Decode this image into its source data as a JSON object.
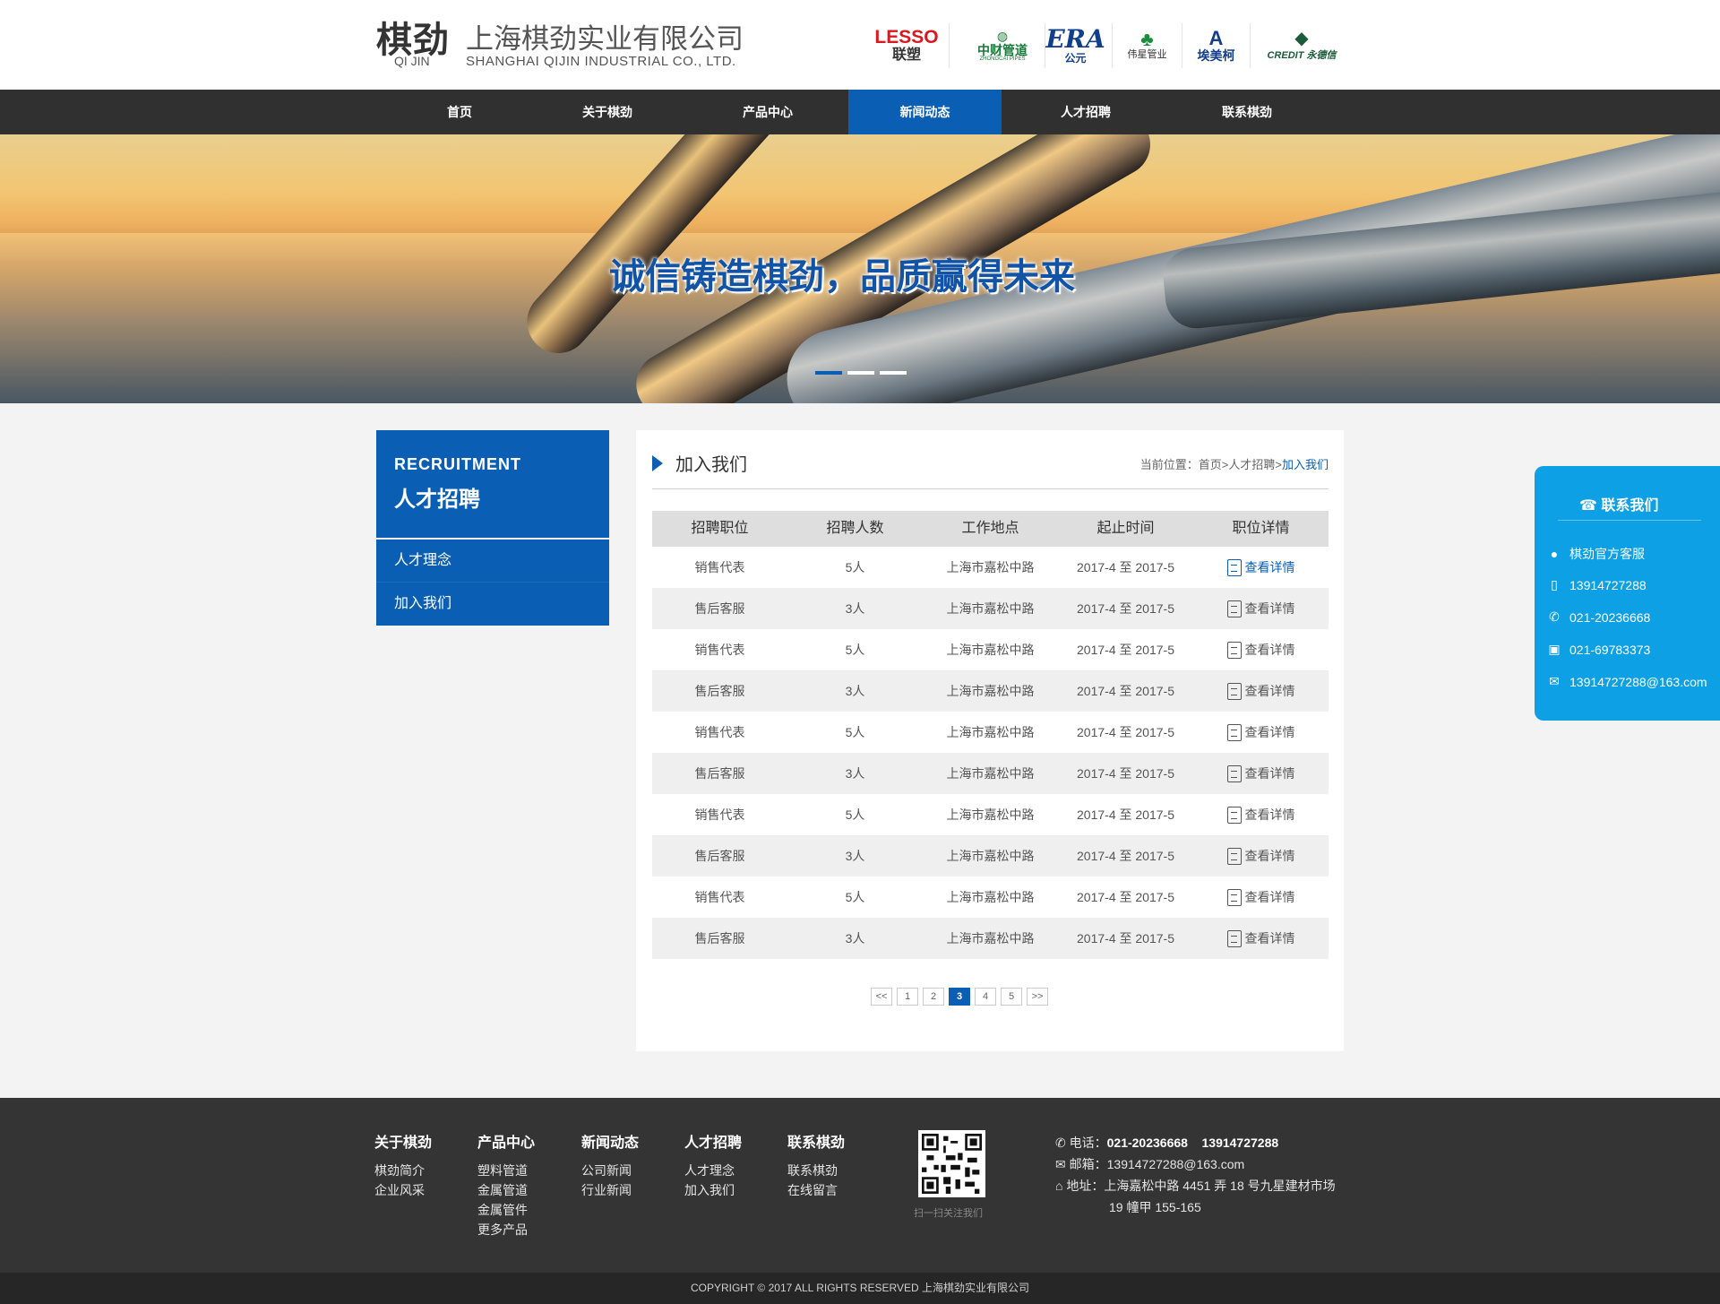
{
  "header": {
    "logo_cn": "棋劲",
    "logo_en": "QI JIN",
    "company_cn": "上海棋劲实业有限公司",
    "company_en": "SHANGHAI QIJIN INDUSTRIAL CO., LTD.",
    "brands": [
      {
        "name": "LESSO",
        "sub": "联塑"
      },
      {
        "name": "中财管道",
        "sub": "ZHONGCAI PIPES"
      },
      {
        "name": "ERA",
        "sub": "公元"
      },
      {
        "name": "伟星管业",
        "sub": ""
      },
      {
        "name": "埃美柯",
        "sub": ""
      },
      {
        "name": "CREDIT",
        "sub": "永德信"
      }
    ]
  },
  "nav": [
    "首页",
    "关于棋劲",
    "产品中心",
    "新闻动态",
    "人才招聘",
    "联系棋劲"
  ],
  "nav_active": "新闻动态",
  "banner": {
    "slogan": "诚信铸造棋劲，品质赢得未来",
    "slides": 3,
    "active_slide": 1
  },
  "sidebar": {
    "title_en": "RECRUITMENT",
    "title_cn": "人才招聘",
    "items": [
      "人才理念",
      "加入我们"
    ]
  },
  "main": {
    "title": "加入我们",
    "breadcrumb_prefix": "当前位置：",
    "breadcrumb": [
      "首页",
      "人才招聘",
      "加入我们"
    ],
    "headers": [
      "招聘职位",
      "招聘人数",
      "工作地点",
      "起止时间",
      "职位详情"
    ],
    "rows": [
      {
        "position": "销售代表",
        "count": "5人",
        "location": "上海市嘉松中路",
        "period": "2017-4 至 2017-5",
        "detail": "查看详情"
      },
      {
        "position": "售后客服",
        "count": "3人",
        "location": "上海市嘉松中路",
        "period": "2017-4 至 2017-5",
        "detail": "查看详情"
      },
      {
        "position": "销售代表",
        "count": "5人",
        "location": "上海市嘉松中路",
        "period": "2017-4 至 2017-5",
        "detail": "查看详情"
      },
      {
        "position": "售后客服",
        "count": "3人",
        "location": "上海市嘉松中路",
        "period": "2017-4 至 2017-5",
        "detail": "查看详情"
      },
      {
        "position": "销售代表",
        "count": "5人",
        "location": "上海市嘉松中路",
        "period": "2017-4 至 2017-5",
        "detail": "查看详情"
      },
      {
        "position": "售后客服",
        "count": "3人",
        "location": "上海市嘉松中路",
        "period": "2017-4 至 2017-5",
        "detail": "查看详情"
      },
      {
        "position": "销售代表",
        "count": "5人",
        "location": "上海市嘉松中路",
        "period": "2017-4 至 2017-5",
        "detail": "查看详情"
      },
      {
        "position": "售后客服",
        "count": "3人",
        "location": "上海市嘉松中路",
        "period": "2017-4 至 2017-5",
        "detail": "查看详情"
      },
      {
        "position": "销售代表",
        "count": "5人",
        "location": "上海市嘉松中路",
        "period": "2017-4 至 2017-5",
        "detail": "查看详情"
      },
      {
        "position": "售后客服",
        "count": "3人",
        "location": "上海市嘉松中路",
        "period": "2017-4 至 2017-5",
        "detail": "查看详情"
      }
    ],
    "pager": [
      "<<",
      "1",
      "2",
      "3",
      "4",
      "5",
      ">>"
    ],
    "pager_active": "3"
  },
  "contact": {
    "title": "联系我们",
    "items": [
      {
        "icon": "qq-icon",
        "text": "棋劲官方客服"
      },
      {
        "icon": "mobile-icon",
        "text": "13914727288"
      },
      {
        "icon": "phone-icon",
        "text": "021-20236668"
      },
      {
        "icon": "fax-icon",
        "text": "021-69783373"
      },
      {
        "icon": "mail-icon",
        "text": "13914727288@163.com"
      }
    ]
  },
  "footer": {
    "columns": [
      {
        "head": "关于棋劲",
        "links": [
          "棋劲简介",
          "企业风采"
        ]
      },
      {
        "head": "产品中心",
        "links": [
          "塑料管道",
          "金属管道",
          "金属管件",
          "更多产品"
        ]
      },
      {
        "head": "新闻动态",
        "links": [
          "公司新闻",
          "行业新闻"
        ]
      },
      {
        "head": "人才招聘",
        "links": [
          "人才理念",
          "加入我们"
        ]
      },
      {
        "head": "联系棋劲",
        "links": [
          "联系棋劲",
          "在线留言"
        ]
      }
    ],
    "qr_caption": "扫一扫关注我们",
    "phone_label": "电话：",
    "phone": "021-20236668",
    "phone2": "13914727288",
    "email_label": "邮箱：",
    "email": "13914727288@163.com",
    "address_label": "地址：",
    "address1": "上海嘉松中路 4451 弄 18 号九星建材市场",
    "address2": "19 幢甲 155-165",
    "copyright": "COPYRIGHT © 2017 ALL RIGHTS RESERVED 上海棋劲实业有限公司"
  }
}
